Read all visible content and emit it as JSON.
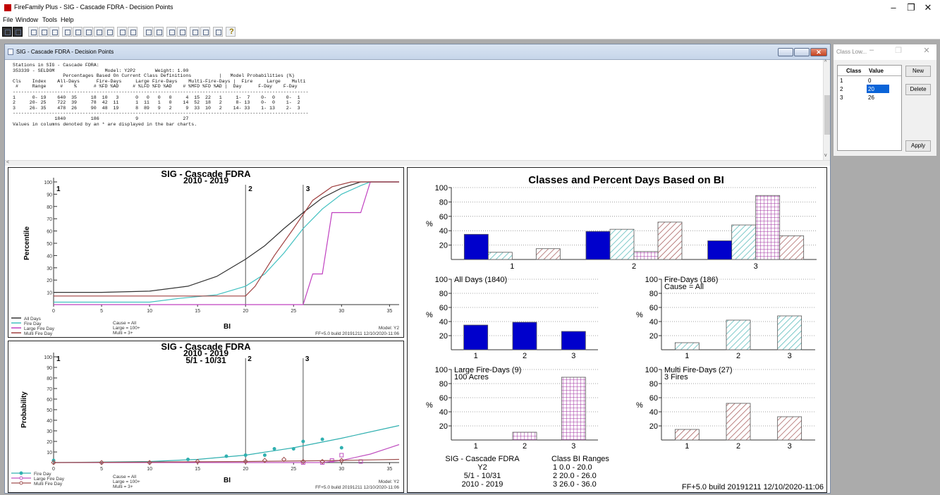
{
  "app": {
    "title": "FireFamily Plus - SIG - Cascade FDRA - Decision Points"
  },
  "window_controls": {
    "minimize": "–",
    "restore": "❐",
    "close": "✕"
  },
  "menu": [
    "File",
    "Window",
    "Tools",
    "Help"
  ],
  "toolbar_icons": [
    "save-icon",
    "print-icon",
    "stations-icon",
    "weather-icon",
    "fuel-model-icon",
    "climatology-icon",
    "percentile-icon",
    "analysis-icon",
    "seasonal-icon",
    "graph-icon",
    "chart-icon",
    "decision-points-icon",
    "class-icon",
    "cumulative-icon",
    "compare-icon",
    "copy-icon",
    "export-icon",
    "settings-icon",
    "zoom-icon",
    "help-icon"
  ],
  "child_window": {
    "title": "SIG - Cascade FDRA - Decision Points"
  },
  "report": {
    "lines": [
      "Stations in SIG - Cascade FDRA:",
      "353339 - SELDOM                  Model: Y2P2       Weight: 1.00",
      "                  Percentages Based On Current Class Definitions          |   Model Probabilities (%)",
      "Cls    Index    All-Days      Fire-Days     Large Fire-Days    Multi-Fire-Days |  Fire     Large    Multi",
      " #     Range     #    %      # %FD %AD     # %LFD %FD %AD    # %MFD %FD %AD |  Day      F-Day    F-Day",
      "----------------------------------------------------------------------------------------------------------",
      "1      0- 19    640  35     18  10   3      0   0   0   0     4  15  22   1     1-  7    0-  0    0-  1",
      "2     20- 25    722  39     78  42  11      1  11   1   0    14  52  18   2     8- 13    0-  0    1-  2",
      "3     26- 35    478  26     90  48  19      8  89   9   2     9  33  10   2    14- 33    1- 13    2-  3",
      "----------------------------------------------------------------------------------------------------------",
      "               1840         186             9                27",
      "Values in columns denoted by an * are displayed in the bar charts."
    ]
  },
  "percentile_chart": {
    "title": "SIG - Cascade FDRA",
    "subtitle": "2010 - 2019",
    "ylabel": "Percentile",
    "xlabel": "BI",
    "legend": [
      "All Days",
      "Fire Day",
      "Large Fire Day",
      "Multi Fire Day"
    ],
    "notes": [
      "Cause = All",
      "Large = 100+",
      "Multi = 3+"
    ],
    "model": "Model: Y2",
    "build": "FF+5.0 build 20191211 12/10/2020-11:06",
    "markers": [
      "1",
      "2",
      "3"
    ]
  },
  "probability_chart": {
    "title": "SIG - Cascade FDRA",
    "subtitle": "2010 - 2019",
    "period": "5/1 - 10/31",
    "ylabel": "Probability",
    "xlabel": "BI",
    "legend": [
      "Fire Day",
      "Large Fire Day",
      "Multi Fire Day"
    ],
    "notes": [
      "Cause = All",
      "Large = 100+",
      "Multi = 3+"
    ],
    "model": "Model: Y2",
    "build": "FF+5.0 build 20191211 12/10/2020-11:06",
    "markers": [
      "2",
      "3"
    ]
  },
  "bar_panel": {
    "title": "Classes and Percent Days Based on BI",
    "sub": [
      "All Days (1840)",
      "Fire-Days (186)",
      "Large Fire-Days (9)",
      "Multi Fire-Days (27)"
    ],
    "sub2": [
      "",
      "Cause = All",
      "100 Acres",
      "3 Fires"
    ],
    "footer_left": [
      "SIG - Cascade FDRA",
      "Y2",
      "5/1 - 10/31",
      "2010 - 2019"
    ],
    "class_ranges_title": "Class BI Ranges",
    "class_ranges": [
      "1  0.0 - 20.0",
      "2  20.0 - 26.0",
      "3  26.0 - 36.0"
    ],
    "build": "FF+5.0 build 20191211 12/10/2020-11:06",
    "percent_label": "%"
  },
  "class_panel": {
    "title": "Class Low...",
    "headers": [
      "Class",
      "Value"
    ],
    "rows": [
      [
        "1",
        "0"
      ],
      [
        "2",
        "20"
      ],
      [
        "3",
        "26"
      ]
    ],
    "buttons": [
      "New",
      "Delete",
      "Apply"
    ]
  },
  "chart_data": [
    {
      "type": "line",
      "title": "SIG - Cascade FDRA",
      "subtitle": "2010 - 2019",
      "xlabel": "BI",
      "ylabel": "Percentile",
      "xlim": [
        0,
        36
      ],
      "ylim": [
        0,
        100
      ],
      "xticks": [
        0,
        5,
        10,
        15,
        20,
        25,
        30,
        35
      ],
      "yticks": [
        10,
        20,
        30,
        40,
        50,
        60,
        70,
        80,
        90,
        100
      ],
      "decision_points": [
        {
          "label": "1",
          "x": 0
        },
        {
          "label": "2",
          "x": 20
        },
        {
          "label": "3",
          "x": 26
        }
      ],
      "series": [
        {
          "name": "All Days",
          "color": "#333333",
          "points": [
            [
              0,
              10
            ],
            [
              5,
              10
            ],
            [
              10,
              11
            ],
            [
              14,
              15
            ],
            [
              17,
              23
            ],
            [
              20,
              37
            ],
            [
              22,
              48
            ],
            [
              24,
              62
            ],
            [
              26,
              75
            ],
            [
              28,
              87
            ],
            [
              30,
              95
            ],
            [
              32,
              100
            ],
            [
              36,
              100
            ]
          ]
        },
        {
          "name": "Fire Day",
          "color": "#40c0c0",
          "points": [
            [
              0,
              2
            ],
            [
              10,
              2
            ],
            [
              13,
              5
            ],
            [
              17,
              8
            ],
            [
              20,
              15
            ],
            [
              22,
              25
            ],
            [
              24,
              42
            ],
            [
              26,
              62
            ],
            [
              28,
              78
            ],
            [
              30,
              90
            ],
            [
              32,
              97
            ],
            [
              33,
              100
            ],
            [
              36,
              100
            ]
          ]
        },
        {
          "name": "Large Fire Day",
          "color": "#c040c0",
          "points": [
            [
              0,
              0
            ],
            [
              26,
              0
            ],
            [
              27,
              25
            ],
            [
              28,
              25
            ],
            [
              29,
              75
            ],
            [
              32,
              75
            ],
            [
              33,
              100
            ],
            [
              36,
              100
            ]
          ]
        },
        {
          "name": "Multi Fire Day",
          "color": "#a04040",
          "points": [
            [
              0,
              7
            ],
            [
              20,
              7
            ],
            [
              21,
              15
            ],
            [
              23,
              40
            ],
            [
              25,
              62
            ],
            [
              27,
              85
            ],
            [
              29,
              96
            ],
            [
              31,
              100
            ],
            [
              36,
              100
            ]
          ]
        }
      ]
    },
    {
      "type": "scatter",
      "title": "SIG - Cascade FDRA",
      "subtitle": "2010 - 2019",
      "xlabel": "BI",
      "ylabel": "Probability",
      "xlim": [
        0,
        36
      ],
      "ylim": [
        0,
        100
      ],
      "xticks": [
        0,
        5,
        10,
        15,
        20,
        25,
        30,
        35
      ],
      "yticks": [
        10,
        20,
        30,
        40,
        50,
        60,
        70,
        80,
        90,
        100
      ],
      "series": [
        {
          "name": "Fire Day",
          "color": "#30b0b0",
          "marker": "circle",
          "points": [
            [
              0,
              2
            ],
            [
              14,
              3
            ],
            [
              18,
              6
            ],
            [
              20,
              7
            ],
            [
              22,
              7
            ],
            [
              23,
              13
            ],
            [
              25,
              13
            ],
            [
              26,
              20
            ],
            [
              28,
              22
            ],
            [
              30,
              14
            ]
          ],
          "fit": [
            [
              0,
              0
            ],
            [
              10,
              1
            ],
            [
              15,
              3
            ],
            [
              20,
              7
            ],
            [
              25,
              14
            ],
            [
              30,
              23
            ],
            [
              36,
              35
            ]
          ]
        },
        {
          "name": "Large Fire Day",
          "color": "#c050c0",
          "marker": "square",
          "points": [
            [
              26,
              0
            ],
            [
              28,
              0
            ],
            [
              29,
              2
            ],
            [
              30,
              7
            ],
            [
              32,
              1
            ]
          ],
          "fit": [
            [
              0,
              0
            ],
            [
              28,
              0
            ],
            [
              30,
              2
            ],
            [
              33,
              8
            ],
            [
              36,
              17
            ]
          ]
        },
        {
          "name": "Multi Fire Day",
          "color": "#a05050",
          "marker": "diamond",
          "points": [
            [
              0,
              0
            ],
            [
              5,
              0
            ],
            [
              10,
              0
            ],
            [
              15,
              1
            ],
            [
              20,
              1
            ],
            [
              22,
              2
            ],
            [
              24,
              3
            ],
            [
              26,
              1
            ],
            [
              28,
              1
            ],
            [
              30,
              2
            ]
          ],
          "fit": [
            [
              0,
              0
            ],
            [
              20,
              1
            ],
            [
              30,
              2
            ],
            [
              36,
              3
            ]
          ]
        }
      ]
    },
    {
      "type": "bar",
      "title": "Classes and Percent Days Based on BI",
      "categories": [
        "1",
        "2",
        "3"
      ],
      "ylim": [
        0,
        100
      ],
      "series": [
        {
          "name": "All Days (1840)",
          "color": "#0000cc",
          "values": [
            35,
            39,
            26
          ]
        },
        {
          "name": "Fire-Days (186)",
          "color": "#6cc8c8",
          "values": [
            10,
            42,
            48
          ]
        },
        {
          "name": "Large Fire-Days (9)",
          "color": "#b040b0",
          "values": [
            0,
            11,
            89
          ]
        },
        {
          "name": "Multi Fire-Days (27)",
          "color": "#b06060",
          "values": [
            15,
            52,
            33
          ]
        }
      ]
    }
  ]
}
